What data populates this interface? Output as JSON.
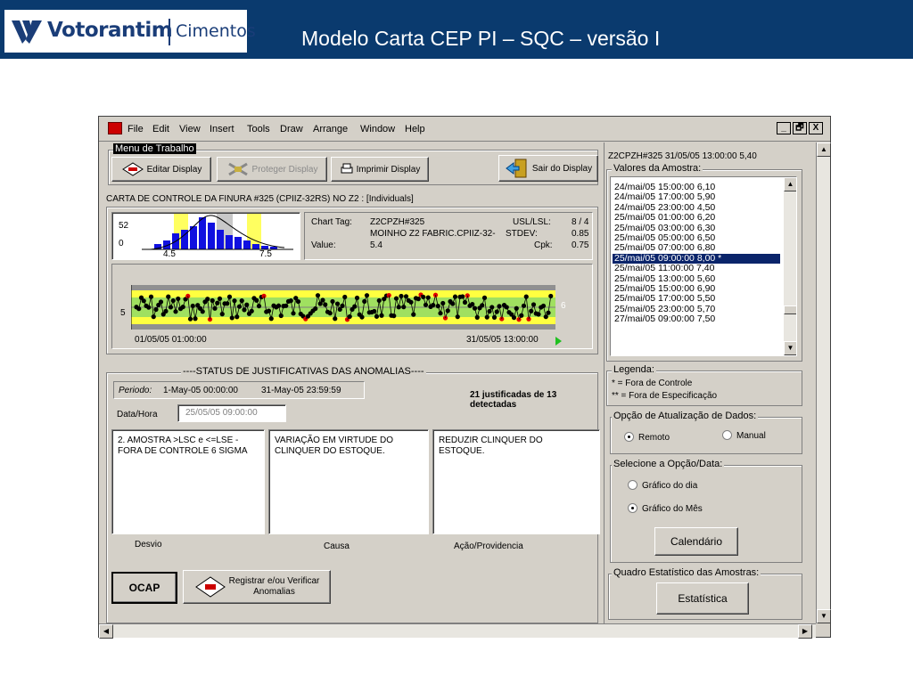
{
  "banner": {
    "brand": "Votorantim",
    "brand_sub": "Cimentos",
    "title": "Modelo Carta CEP PI – SQC – versão I",
    "bg_color": "#0a3a6e"
  },
  "menubar": {
    "items": [
      "File",
      "Edit",
      "View",
      "Insert",
      "Tools",
      "Draw",
      "Arrange",
      "Window",
      "Help"
    ],
    "controls": [
      "_",
      "🗗",
      "X"
    ]
  },
  "work_menu": {
    "title": "Menu de Trabalho",
    "edit_display": "Editar Display",
    "protect_display": "Proteger Display",
    "print_display": "Imprimir Display",
    "exit_display": "Sair do Display"
  },
  "chart_header": "CARTA DE CONTROLE DA FINURA #325 (CPIIZ-32RS) NO Z2 : [Individuals]",
  "histogram": {
    "ymax_label": "52",
    "ymin_label": "0",
    "x_labels": [
      "4.5",
      "7.5"
    ]
  },
  "chart_info": {
    "chart_tag_label": "Chart Tag:",
    "chart_tag": "Z2CPZH#325",
    "description": "MOINHO Z2 FABRIC.CPIIZ-32-",
    "value_label": "Value:",
    "value": "5.4",
    "usl_lsl_label": "USL/LSL:",
    "usl_lsl": "8 / 4",
    "stdev_label": "STDEV:",
    "stdev": "0.85",
    "cpk_label": "Cpk:",
    "cpk": "0.75"
  },
  "control_chart": {
    "y_label": "5",
    "right_label": "6",
    "start_time": "01/05/05 01:00:00",
    "end_time": "31/05/05 13:00:00"
  },
  "status": {
    "title": "----STATUS DE JUSTIFICATIVAS DAS ANOMALIAS----",
    "period_label": "Periodo:",
    "period_start": "1-May-05 00:00:00",
    "period_end": "31-May-05 23:59:59",
    "summary": "21 justificadas de 13 detectadas",
    "datetime_label": "Data/Hora",
    "datetime_value": "25/05/05 09:00:00",
    "desvio_text": "2. AMOSTRA >LSC e <=LSE - FORA DE CONTROLE 6 SIGMA",
    "causa_text": "VARIAÇÃO EM VIRTUDE DO CLINQUER DO ESTOQUE.",
    "acao_text": "REDUZIR CLINQUER DO ESTOQUE.",
    "desvio_label": "Desvio",
    "causa_label": "Causa",
    "acao_label": "Ação/Providencia",
    "ocap_button": "OCAP",
    "register_button_line1": "Registrar e/ou Verificar",
    "register_button_line2": "Anomalias"
  },
  "right_panel": {
    "header": "Z2CPZH#325   31/05/05 13:00:00  5,40",
    "samples_label": "Valores da Amostra:",
    "samples": [
      "24/mai/05 15:00:00  6,10",
      "24/mai/05 17:00:00  5,90",
      "24/mai/05 23:00:00  4,50",
      "25/mai/05 01:00:00  6,20",
      "25/mai/05 03:00:00  6,30",
      "25/mai/05 05:00:00  6,50",
      "25/mai/05 07:00:00  6,80",
      "25/mai/05 09:00:00  8,00  *",
      "25/mai/05 11:00:00  7,40",
      "25/mai/05 13:00:00  5,60",
      "25/mai/05 15:00:00  6,90",
      "25/mai/05 17:00:00  5,50",
      "25/mai/05 23:00:00  5,70",
      "27/mai/05 09:00:00  7,50"
    ],
    "selected_index": 7,
    "legend_label": "Legenda:",
    "legend_1": "*   = Fora de Controle",
    "legend_2": "** = Fora de Especificação",
    "update_label": "Opção de Atualização de Dados:",
    "remote": "Remoto",
    "manual": "Manual",
    "select_label": "Selecione a Opção/Data:",
    "day_chart": "Gráfico do dia",
    "month_chart": "Gráfico do Mês",
    "calendar_button": "Calendário",
    "stats_label": "Quadro Estatístico das Amostras:",
    "stats_button": "Estatística"
  }
}
